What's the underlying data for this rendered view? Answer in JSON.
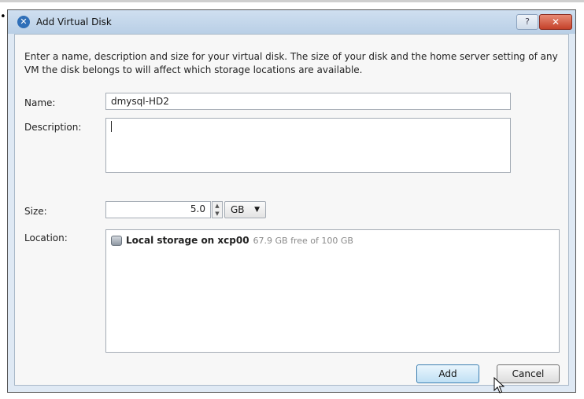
{
  "dialog": {
    "title": "Add Virtual Disk",
    "help_label": "?",
    "close_label": "✕"
  },
  "intro": "Enter a name, description and size for your virtual disk. The size of your disk and the home server setting of any VM the disk belongs to will affect which storage locations are available.",
  "form": {
    "name_label": "Name:",
    "name_value": "dmysql-HD2",
    "description_label": "Description:",
    "description_value": "",
    "size_label": "Size:",
    "size_value": "5.0",
    "size_unit": "GB",
    "location_label": "Location:"
  },
  "locations": [
    {
      "name": "Local storage on xcp00",
      "free": "67.9 GB free of 100 GB",
      "icon": "disk-icon"
    }
  ],
  "buttons": {
    "add": "Add",
    "cancel": "Cancel"
  },
  "colors": {
    "title_bar": "#b9cfe6",
    "close_button": "#c4412a",
    "default_button_border": "#3c7fb1"
  }
}
